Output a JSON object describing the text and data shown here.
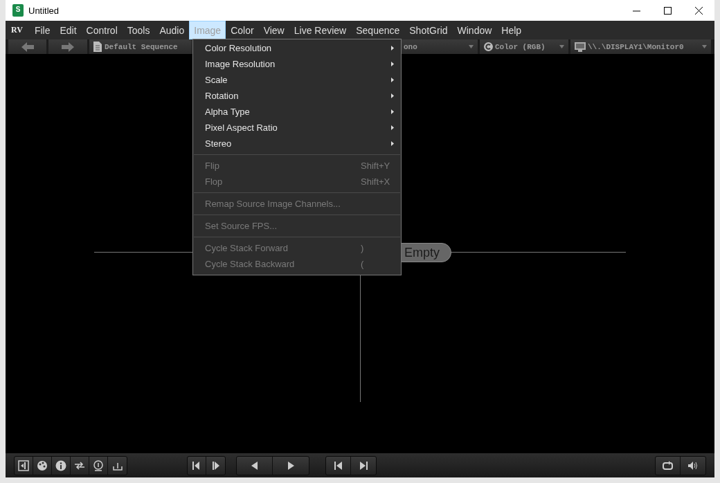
{
  "window": {
    "title": "Untitled",
    "icon_letter": "S"
  },
  "menubar": {
    "logo": "RV",
    "items": [
      {
        "label": "File",
        "selected": false
      },
      {
        "label": "Edit",
        "selected": false
      },
      {
        "label": "Control",
        "selected": false
      },
      {
        "label": "Tools",
        "selected": false
      },
      {
        "label": "Audio",
        "selected": false
      },
      {
        "label": "Image",
        "selected": true
      },
      {
        "label": "Color",
        "selected": false
      },
      {
        "label": "View",
        "selected": false
      },
      {
        "label": "Live Review",
        "selected": false
      },
      {
        "label": "Sequence",
        "selected": false
      },
      {
        "label": "ShotGrid",
        "selected": false
      },
      {
        "label": "Window",
        "selected": false
      },
      {
        "label": "Help",
        "selected": false
      }
    ]
  },
  "toolbar": {
    "sequence": "Default Sequence",
    "stereo": "ono",
    "color_mode": "Color (RGB)",
    "display": "\\\\.\\DISPLAY1\\Monitor0"
  },
  "image_menu": [
    {
      "kind": "submenu",
      "label": "Color Resolution",
      "disabled": false
    },
    {
      "kind": "submenu",
      "label": "Image Resolution",
      "disabled": false
    },
    {
      "kind": "submenu",
      "label": "Scale",
      "disabled": false
    },
    {
      "kind": "submenu",
      "label": "Rotation",
      "disabled": false
    },
    {
      "kind": "submenu",
      "label": "Alpha Type",
      "disabled": false
    },
    {
      "kind": "submenu",
      "label": "Pixel Aspect Ratio",
      "disabled": false
    },
    {
      "kind": "submenu",
      "label": "Stereo",
      "disabled": false
    },
    {
      "kind": "separator"
    },
    {
      "kind": "item",
      "label": "Flip",
      "shortcut": "Shift+Y",
      "disabled": true
    },
    {
      "kind": "item",
      "label": "Flop",
      "shortcut": "Shift+X",
      "disabled": true
    },
    {
      "kind": "separator"
    },
    {
      "kind": "item",
      "label": "Remap Source Image Channels...",
      "disabled": true
    },
    {
      "kind": "separator"
    },
    {
      "kind": "item",
      "label": "Set Source FPS...",
      "disabled": true
    },
    {
      "kind": "separator"
    },
    {
      "kind": "item",
      "label": "Cycle Stack Forward",
      "shortcut": ")",
      "disabled": true
    },
    {
      "kind": "item",
      "label": "Cycle Stack Backward",
      "shortcut": "(",
      "disabled": true
    }
  ],
  "viewer": {
    "label": "Empty"
  }
}
